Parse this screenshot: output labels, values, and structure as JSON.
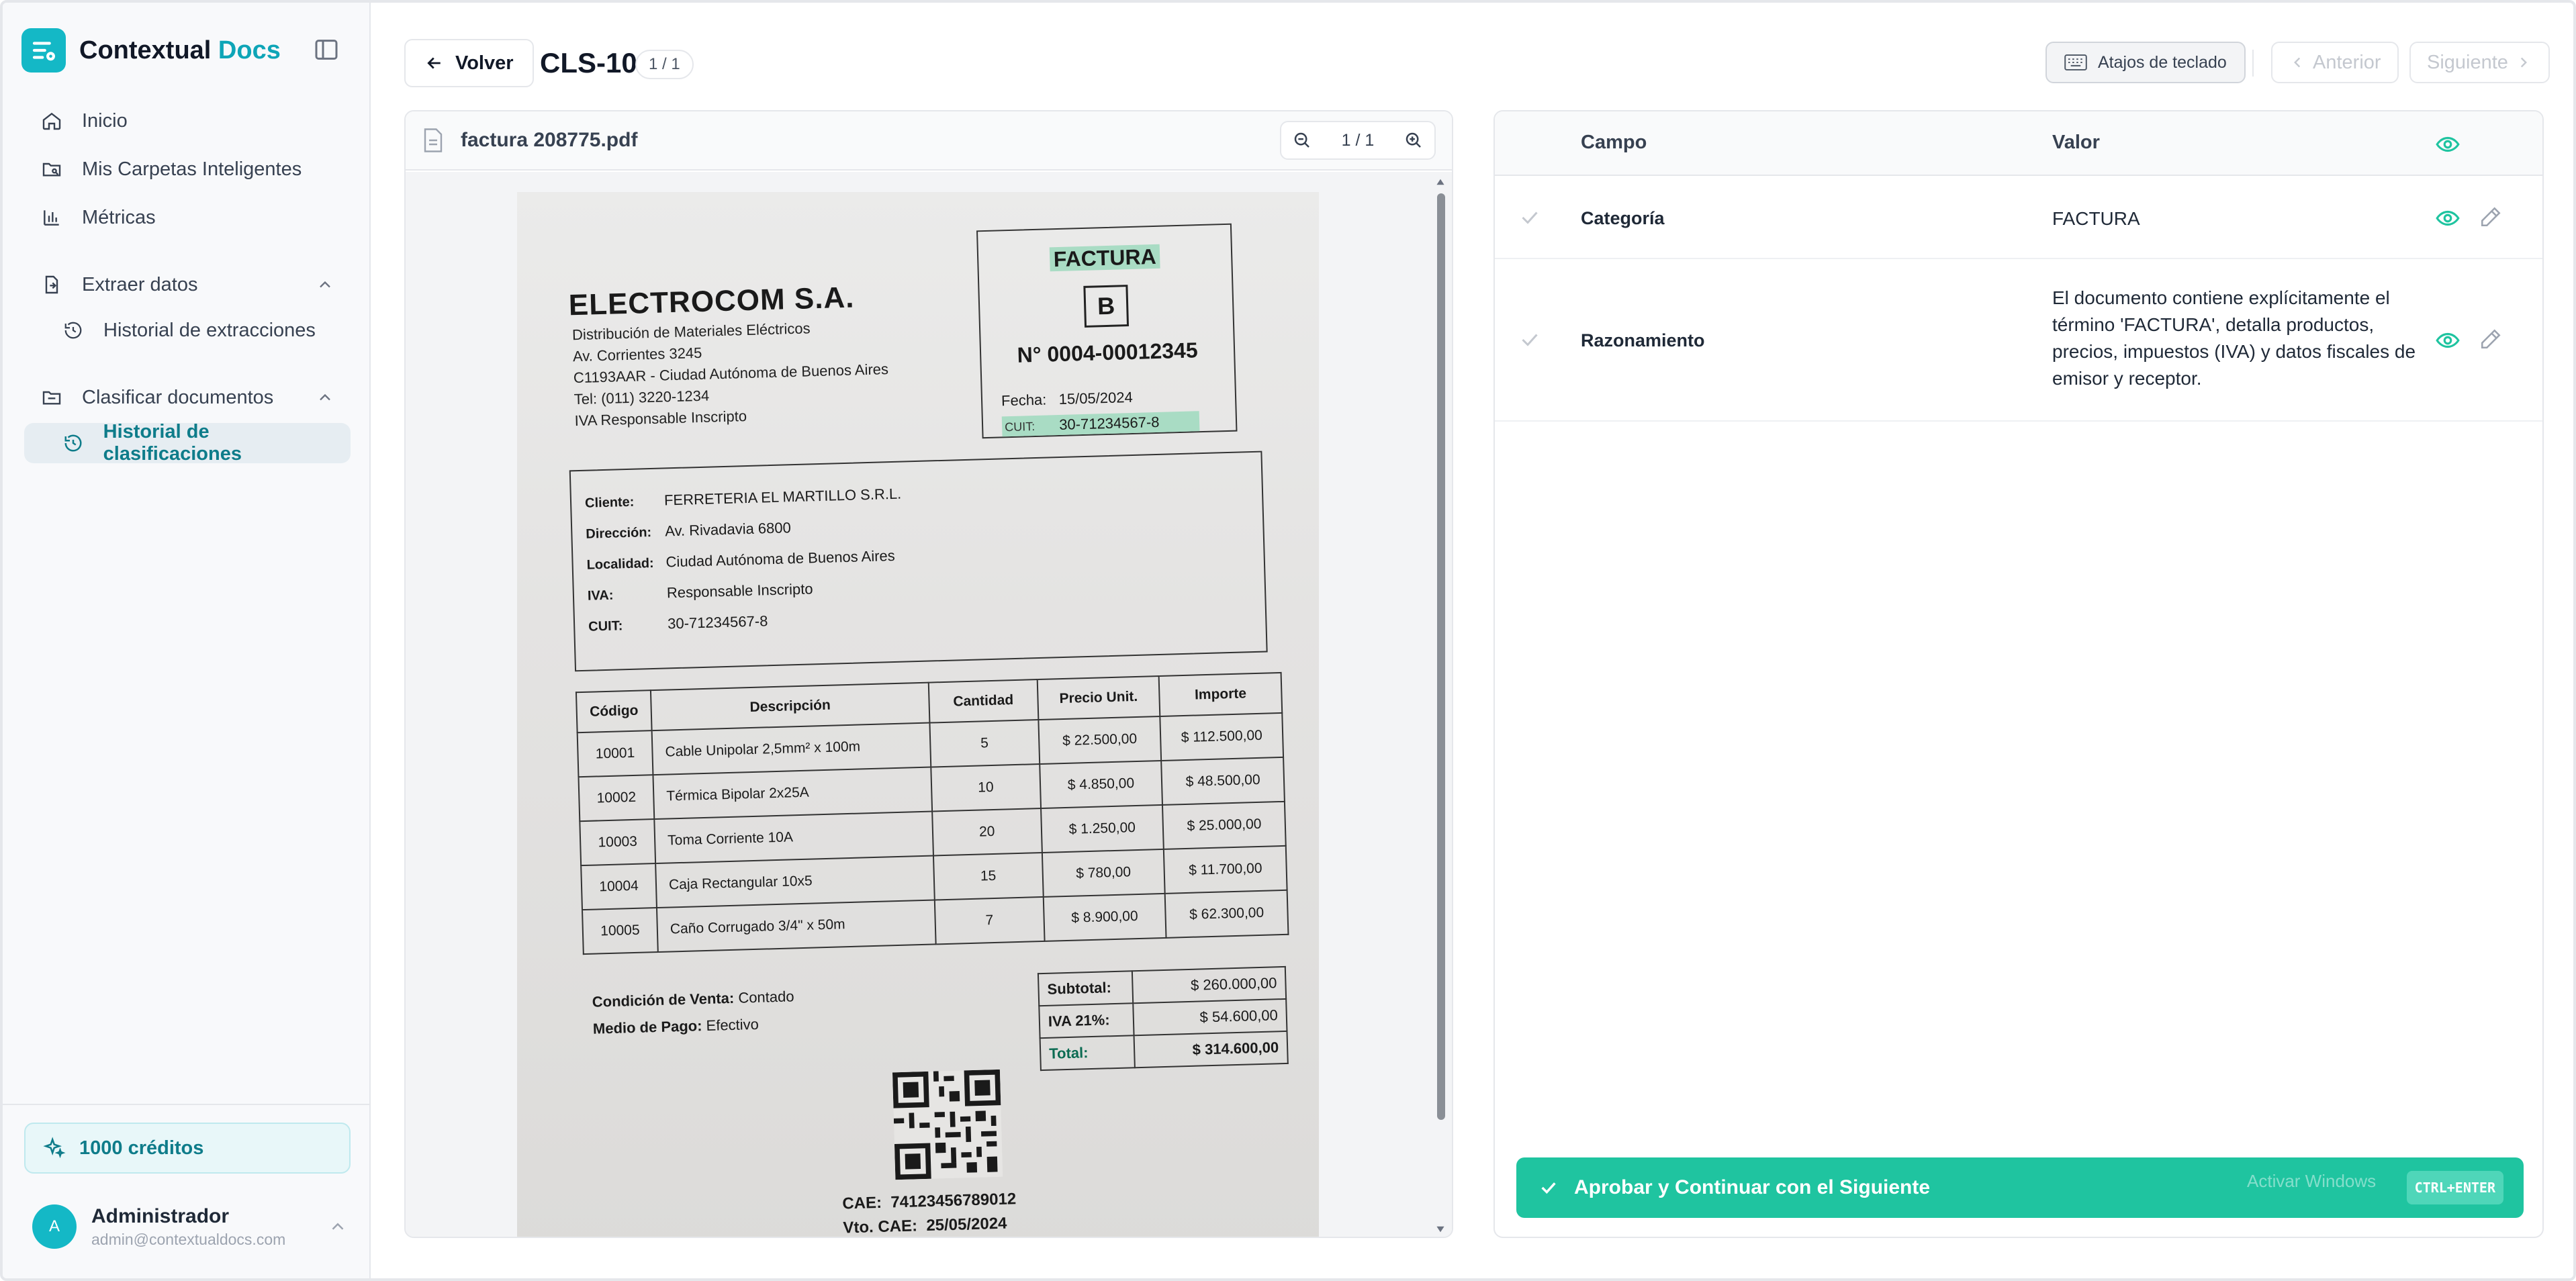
{
  "sidebar": {
    "brand": {
      "name": "Contextual",
      "accent": "Docs"
    },
    "items": [
      {
        "label": "Inicio",
        "icon": "home-icon"
      },
      {
        "label": "Mis Carpetas Inteligentes",
        "icon": "folder-smart-icon"
      },
      {
        "label": "Métricas",
        "icon": "bar-chart-icon"
      }
    ],
    "groups": [
      {
        "label": "Extraer datos",
        "icon": "file-extract-icon",
        "sub": [
          {
            "label": "Historial de extracciones",
            "icon": "history-icon"
          }
        ]
      },
      {
        "label": "Clasificar documentos",
        "icon": "folder-classify-icon",
        "sub": [
          {
            "label": "Historial de clasificaciones",
            "icon": "history-icon",
            "active": true
          }
        ]
      }
    ],
    "credits": "1000 créditos",
    "user": {
      "initial": "A",
      "name": "Administrador",
      "email": "admin@contextualdocs.com"
    }
  },
  "topbar": {
    "back_label": "Volver",
    "doc_id": "CLS-10",
    "doc_count": "1 / 1",
    "shortcuts_label": "Atajos de teclado",
    "prev_label": "Anterior",
    "next_label": "Siguiente"
  },
  "viewer": {
    "file_name": "factura 208775.pdf",
    "page_indicator": "1 / 1"
  },
  "invoice": {
    "company": "ELECTROCOM S.A.",
    "company_lines": [
      "Distribución de Materiales Eléctricos",
      "Av. Corrientes 3245",
      "C1193AAR - Ciudad Autónoma de Buenos Aires",
      "Tel: (011) 3220-1234",
      "IVA Responsable Inscripto"
    ],
    "doc_type": "FACTURA",
    "letter": "B",
    "number": "N° 0004-00012345",
    "date_label": "Fecha:",
    "date": "15/05/2024",
    "cuit_label": "CUIT:",
    "cuit": "30-71234567-8",
    "client": [
      {
        "k": "Cliente:",
        "v": "FERRETERIA EL MARTILLO S.R.L."
      },
      {
        "k": "Dirección:",
        "v": "Av. Rivadavia 6800"
      },
      {
        "k": "Localidad:",
        "v": "Ciudad Autónoma de Buenos Aires"
      },
      {
        "k": "IVA:",
        "v": "Responsable Inscripto"
      },
      {
        "k": "CUIT:",
        "v": "30-71234567-8"
      }
    ],
    "columns": [
      "Código",
      "Descripción",
      "Cantidad",
      "Precio Unit.",
      "Importe"
    ],
    "rows": [
      [
        "10001",
        "Cable Unipolar 2,5mm² x 100m",
        "5",
        "$ 22.500,00",
        "$ 112.500,00"
      ],
      [
        "10002",
        "Térmica Bipolar 2x25A",
        "10",
        "$ 4.850,00",
        "$ 48.500,00"
      ],
      [
        "10003",
        "Toma Corriente 10A",
        "20",
        "$ 1.250,00",
        "$ 25.000,00"
      ],
      [
        "10004",
        "Caja Rectangular 10x5",
        "15",
        "$ 780,00",
        "$ 11.700,00"
      ],
      [
        "10005",
        "Caño Corrugado 3/4\" x 50m",
        "7",
        "$ 8.900,00",
        "$ 62.300,00"
      ]
    ],
    "cond_label": "Condición de Venta:",
    "cond": "Contado",
    "pay_label": "Medio de Pago:",
    "pay": "Efectivo",
    "totals": [
      {
        "k": "Subtotal:",
        "v": "$ 260.000,00"
      },
      {
        "k": "IVA 21%:",
        "v": "$ 54.600,00"
      },
      {
        "k": "Total:",
        "v": "$ 314.600,00"
      }
    ],
    "cae_label": "CAE:",
    "cae": "74123456789012",
    "vto_label": "Vto. CAE:",
    "vto": "25/05/2024"
  },
  "panel": {
    "col_field": "Campo",
    "col_value": "Valor",
    "fields": [
      {
        "name": "Categoría",
        "value": "FACTURA"
      },
      {
        "name": "Razonamiento",
        "value": "El documento contiene explícitamente el término 'FACTURA', detalla productos, precios, impuestos (IVA) y datos fiscales de emisor y receptor."
      }
    ],
    "approve_label": "Aprobar y Continuar con el Siguiente",
    "approve_shortcut": "CTRL+ENTER",
    "watermark": "Activar Windows"
  },
  "colors": {
    "accent": "#14b8c6",
    "approve": "#1fc4a0",
    "highlight": "#a9dcc4"
  }
}
